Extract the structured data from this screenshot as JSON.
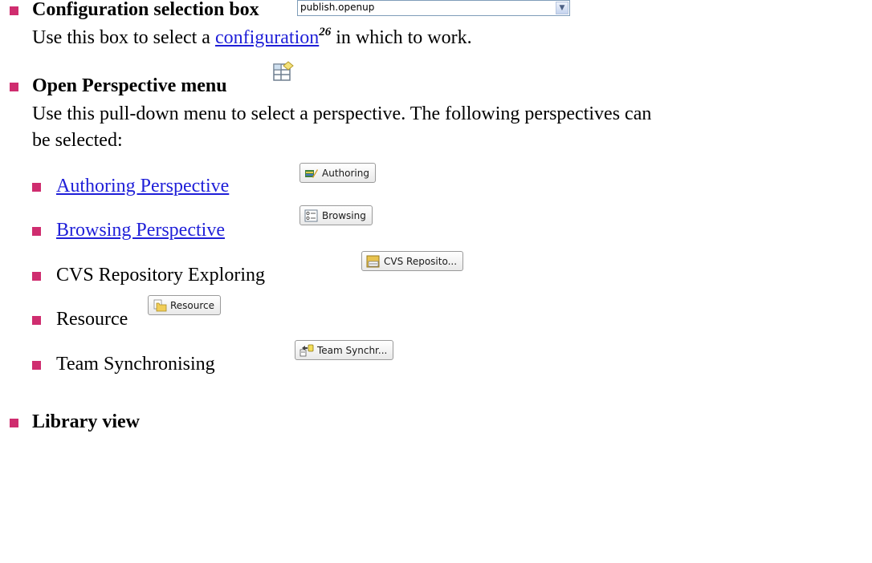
{
  "config": {
    "title": "Configuration selection box",
    "combo_value": "publish.openup",
    "desc_before": "Use this box to select a",
    "desc_link": "configuration",
    "footnote": "26",
    "desc_after": "in which to work."
  },
  "perspective_menu": {
    "title": "Open Perspective menu",
    "desc_line1": "Use this pull-down menu to select a perspective.  The following perspectives can",
    "desc_line2": "be selected:",
    "items": [
      {
        "label": "Authoring Perspective",
        "is_link": true,
        "button_label": "Authoring",
        "icon": "authoring-icon"
      },
      {
        "label": "Browsing Perspective",
        "is_link": true,
        "button_label": "Browsing",
        "icon": "browsing-icon"
      },
      {
        "label": "CVS Repository Exploring",
        "is_link": false,
        "button_label": "CVS Reposito...",
        "icon": "cvs-icon"
      },
      {
        "label": "Resource",
        "is_link": false,
        "button_label": "Resource",
        "icon": "resource-icon"
      },
      {
        "label": "Team Synchronising",
        "is_link": false,
        "button_label": "Team Synchr...",
        "icon": "team-sync-icon"
      }
    ]
  },
  "library": {
    "title": "Library view"
  },
  "colors": {
    "bullet": "#cf2d6f",
    "link": "#1f1fd8"
  }
}
